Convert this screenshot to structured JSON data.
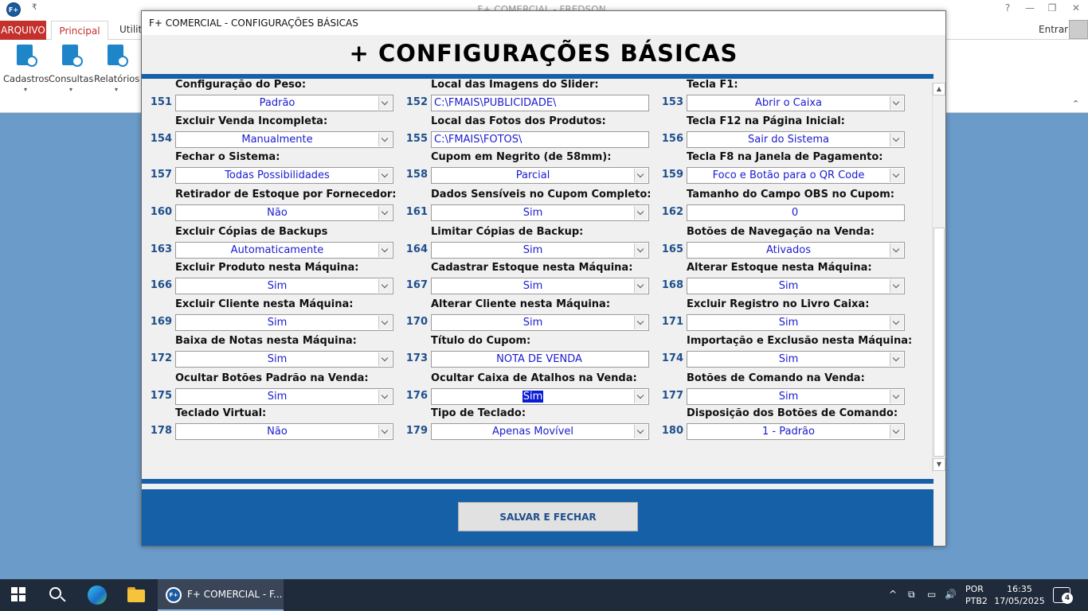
{
  "app": {
    "title": "F+ COMERCIAL - FREDSON",
    "logo_text": "F+",
    "help_glyph": "?",
    "min_glyph": "—",
    "restore_glyph": "❐",
    "close_glyph": "✕",
    "qat_glyph": "₹",
    "tabs": {
      "arquivo": "ARQUIVO",
      "principal": "Principal",
      "utilit": "Utilit"
    },
    "entrar": "Entrar",
    "ribbon": [
      {
        "label": "Cadastros"
      },
      {
        "label": "Consultas"
      },
      {
        "label": "Relatórios"
      }
    ],
    "caret": "▾",
    "collapse": "⌃"
  },
  "dialog": {
    "title": "F+ COMERCIAL - CONFIGURAÇÕES BÁSICAS",
    "heading": "+ CONFIGURAÇÕES BÁSICAS",
    "save_close": "SALVAR E FECHAR",
    "accent_color": "#1660a8",
    "value_color": "#1b1bd0",
    "number_color": "#1e4f8c",
    "fields": [
      {
        "num": "151",
        "label": "Configuração do Peso:",
        "value": "Padrão",
        "type": "select"
      },
      {
        "num": "152",
        "label": "Local das Imagens do Slider:",
        "value": "C:\\FMAIS\\PUBLICIDADE\\",
        "type": "text-left"
      },
      {
        "num": "153",
        "label": "Tecla F1:",
        "value": "Abrir o Caixa",
        "type": "select"
      },
      {
        "num": "154",
        "label": "Excluir Venda Incompleta:",
        "value": "Manualmente",
        "type": "select"
      },
      {
        "num": "155",
        "label": "Local das Fotos dos Produtos:",
        "value": "C:\\FMAIS\\FOTOS\\",
        "type": "text-left"
      },
      {
        "num": "156",
        "label": "Tecla F12 na Página Inicial:",
        "value": "Sair do Sistema",
        "type": "select"
      },
      {
        "num": "157",
        "label": "Fechar o Sistema:",
        "value": "Todas Possibilidades",
        "type": "select"
      },
      {
        "num": "158",
        "label": "Cupom em Negrito (de 58mm):",
        "value": "Parcial",
        "type": "select"
      },
      {
        "num": "159",
        "label": "Tecla F8 na Janela de Pagamento:",
        "value": "Foco e Botão para o QR Code",
        "type": "select"
      },
      {
        "num": "160",
        "label": "Retirador de Estoque por Fornecedor:",
        "value": "Não",
        "type": "select"
      },
      {
        "num": "161",
        "label": "Dados Sensíveis no Cupom Completo:",
        "value": "Sim",
        "type": "select"
      },
      {
        "num": "162",
        "label": "Tamanho do Campo OBS no Cupom:",
        "value": "0",
        "type": "text"
      },
      {
        "num": "163",
        "label": "Excluir Cópias de Backups",
        "value": "Automaticamente",
        "type": "select"
      },
      {
        "num": "164",
        "label": "Limitar Cópias de Backup:",
        "value": "Sim",
        "type": "select"
      },
      {
        "num": "165",
        "label": "Botões de Navegação na Venda:",
        "value": "Ativados",
        "type": "select"
      },
      {
        "num": "166",
        "label": "Excluir Produto nesta Máquina:",
        "value": "Sim",
        "type": "select"
      },
      {
        "num": "167",
        "label": "Cadastrar Estoque nesta Máquina:",
        "value": "Sim",
        "type": "select"
      },
      {
        "num": "168",
        "label": "Alterar Estoque nesta Máquina:",
        "value": "Sim",
        "type": "select"
      },
      {
        "num": "169",
        "label": "Excluir Cliente nesta Máquina:",
        "value": "Sim",
        "type": "select"
      },
      {
        "num": "170",
        "label": "Alterar Cliente nesta Máquina:",
        "value": "Sim",
        "type": "select"
      },
      {
        "num": "171",
        "label": "Excluir Registro no Livro Caixa:",
        "value": "Sim",
        "type": "select"
      },
      {
        "num": "172",
        "label": "Baixa de Notas nesta Máquina:",
        "value": "Sim",
        "type": "select"
      },
      {
        "num": "173",
        "label": "Título do Cupom:",
        "value": "NOTA DE VENDA",
        "type": "text"
      },
      {
        "num": "174",
        "label": "Importação e Exclusão nesta Máquina:",
        "value": "Sim",
        "type": "select"
      },
      {
        "num": "175",
        "label": "Ocultar Botões Padrão na Venda:",
        "value": "Sim",
        "type": "select"
      },
      {
        "num": "176",
        "label": "Ocultar Caixa de Atalhos na Venda:",
        "value": "Sim",
        "type": "select-selected"
      },
      {
        "num": "177",
        "label": "Botões de Comando na Venda:",
        "value": "Sim",
        "type": "select"
      },
      {
        "num": "178",
        "label": "Teclado Virtual:",
        "value": "Não",
        "type": "select"
      },
      {
        "num": "179",
        "label": "Tipo de Teclado:",
        "value": "Apenas Movível",
        "type": "select"
      },
      {
        "num": "180",
        "label": "Disposição dos Botões de Comando:",
        "value": "1 - Padrão",
        "type": "select"
      }
    ],
    "scroll_up": "▲",
    "scroll_down": "▼"
  },
  "taskbar": {
    "task_label": "F+ COMERCIAL - F...",
    "task_logo": "F+",
    "tray_caret": "^",
    "lang_1": "POR",
    "lang_2": "PTB2",
    "time": "16:35",
    "date": "17/05/2025",
    "notifications": "4",
    "tray_icons": [
      "⧉",
      "▭",
      "🔊"
    ]
  }
}
